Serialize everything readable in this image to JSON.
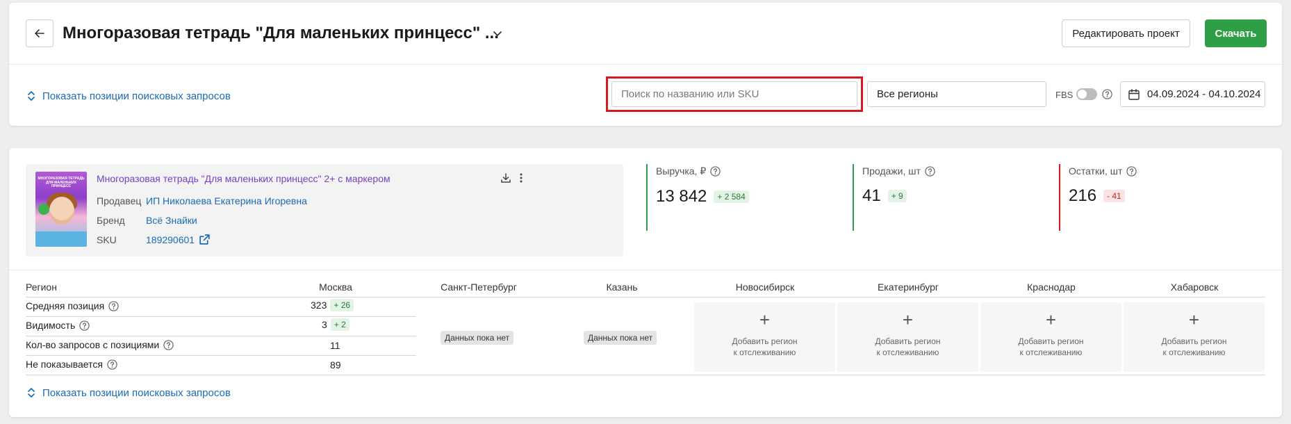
{
  "header": {
    "title": "Многоразовая тетрадь \"Для маленьких принцесс\" ...",
    "edit_label": "Редактировать проект",
    "download_label": "Скачать",
    "accent_color": "#2e9f46"
  },
  "filters": {
    "show_positions_label": "Показать позиции поисковых запросов",
    "search_placeholder": "Поиск по названию или SKU",
    "region_value": "Все регионы",
    "fbs_label": "FBS",
    "date_range": "04.09.2024 - 04.10.2024"
  },
  "product": {
    "title": "Многоразовая тетрадь \"Для маленьких принцесс\" 2+ с маркером",
    "seller_label": "Продавец",
    "seller_value": "ИП Николаева Екатерина Игоревна",
    "brand_label": "Бренд",
    "brand_value": "Всё Знайки",
    "sku_label": "SKU",
    "sku_value": "189290601",
    "cover_title": "МНОГОРАЗОВАЯ ТЕТРАДЬ ДЛЯ МАЛЕНЬКИХ ПРИНЦЕСС"
  },
  "metrics": [
    {
      "label": "Выручка, ₽",
      "value": "13 842",
      "delta": "+ 2 584",
      "trend": "up",
      "color": "#2e9f46"
    },
    {
      "label": "Продажи, шт",
      "value": "41",
      "delta": "+ 9",
      "trend": "up",
      "color": "#2e9f46"
    },
    {
      "label": "Остатки, шт",
      "value": "216",
      "delta": "- 41",
      "trend": "down",
      "color": "#d7191f"
    }
  ],
  "table": {
    "region_header": "Регион",
    "regions": [
      "Москва",
      "Санкт-Петербург",
      "Казань",
      "Новосибирск",
      "Екатеринбург",
      "Краснодар",
      "Хабаровск"
    ],
    "rows": [
      {
        "label": "Средняя позиция",
        "value": "323",
        "delta": "+ 26"
      },
      {
        "label": "Видимость",
        "value": "3",
        "delta": "+ 2"
      },
      {
        "label": "Кол-во запросов с позициями",
        "value": "11",
        "delta": ""
      },
      {
        "label": "Не показывается",
        "value": "89",
        "delta": ""
      }
    ],
    "no_data_label": "Данных пока нет",
    "add_plus": "+",
    "add_region_line1": "Добавить регион",
    "add_region_line2": "к отслеживанию",
    "show_positions_label": "Показать позиции поисковых запросов"
  }
}
